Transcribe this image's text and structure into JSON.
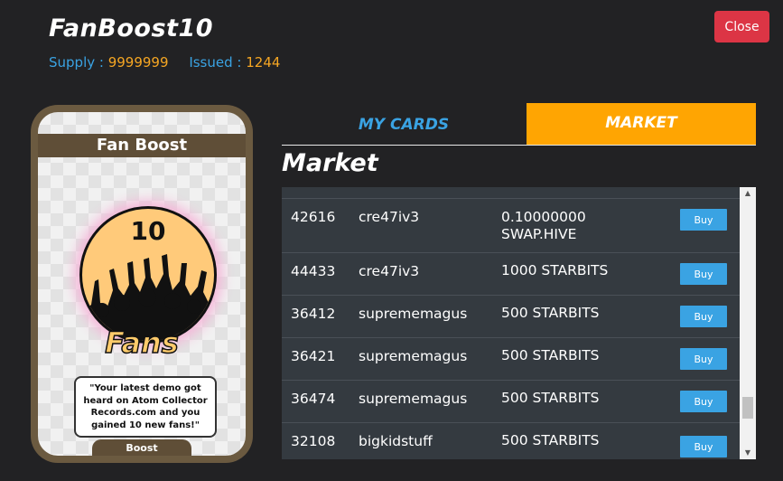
{
  "header": {
    "title": "FanBoost10",
    "supply_label": "Supply :",
    "supply_value": "9999999",
    "issued_label": "Issued :",
    "issued_value": "1244",
    "close_label": "Close"
  },
  "card": {
    "name": "Fan Boost",
    "number": "10",
    "word": "Fans",
    "description": "\"Your latest demo got heard on Atom Collector Records.com and you gained 10 new fans!\"",
    "footer": "Boost"
  },
  "tabs": [
    {
      "label": "MY CARDS",
      "active": false
    },
    {
      "label": "MARKET",
      "active": true
    }
  ],
  "market": {
    "title": "Market",
    "buy_label": "Buy",
    "rows": [
      {
        "id": "42616",
        "seller": "cre47iv3",
        "price": "0.10000000 SWAP.HIVE"
      },
      {
        "id": "44433",
        "seller": "cre47iv3",
        "price": "1000 STARBITS"
      },
      {
        "id": "36412",
        "seller": "suprememagus",
        "price": "500 STARBITS"
      },
      {
        "id": "36421",
        "seller": "suprememagus",
        "price": "500 STARBITS"
      },
      {
        "id": "36474",
        "seller": "suprememagus",
        "price": "500 STARBITS"
      },
      {
        "id": "32108",
        "seller": "bigkidstuff",
        "price": "500 STARBITS"
      }
    ]
  },
  "icons": {
    "scroll_up": "scroll-up-arrow-icon",
    "scroll_down": "scroll-down-arrow-icon"
  },
  "colors": {
    "accent_blue": "#3aa3e3",
    "accent_orange": "#ffa502",
    "close_red": "#dc3545",
    "value_orange": "#f5a623"
  }
}
